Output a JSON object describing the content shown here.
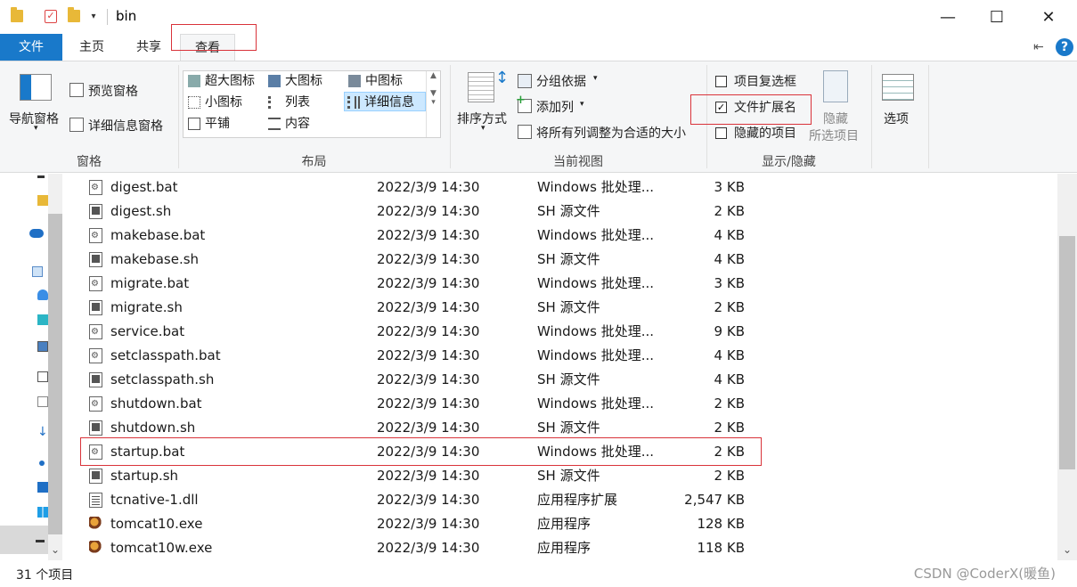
{
  "window": {
    "title": "bin",
    "minimize": "—",
    "maximize": "☐",
    "close": "✕"
  },
  "ribbon_tabs": {
    "file": "文件",
    "home": "主页",
    "share": "共享",
    "view": "查看"
  },
  "ribbon": {
    "panes": {
      "nav_pane": "导航窗格",
      "preview_pane": "预览窗格",
      "details_pane": "详细信息窗格",
      "group_label": "窗格"
    },
    "layout": {
      "items": [
        "超大图标",
        "大图标",
        "中图标",
        "小图标",
        "列表",
        "详细信息",
        "平铺",
        "内容"
      ],
      "selected": "详细信息",
      "group_label": "布局"
    },
    "current_view": {
      "sort_by": "排序方式",
      "group_by": "分组依据",
      "add_column": "添加列",
      "fit_columns": "将所有列调整为合适的大小",
      "group_label": "当前视图"
    },
    "show_hide": {
      "item_checkboxes": "项目复选框",
      "file_extensions": "文件扩展名",
      "hidden_items": "隐藏的项目",
      "hide_selected": "隐藏",
      "hide_selected_2": "所选项目",
      "group_label": "显示/隐藏",
      "checks": {
        "item_checkboxes": false,
        "file_extensions": true,
        "hidden_items": false
      }
    },
    "options": "选项"
  },
  "files": [
    {
      "name": "digest.bat",
      "date": "2022/3/9 14:30",
      "type": "Windows 批处理...",
      "size": "3 KB",
      "icon": "bat"
    },
    {
      "name": "digest.sh",
      "date": "2022/3/9 14:30",
      "type": "SH 源文件",
      "size": "2 KB",
      "icon": "sh"
    },
    {
      "name": "makebase.bat",
      "date": "2022/3/9 14:30",
      "type": "Windows 批处理...",
      "size": "4 KB",
      "icon": "bat"
    },
    {
      "name": "makebase.sh",
      "date": "2022/3/9 14:30",
      "type": "SH 源文件",
      "size": "4 KB",
      "icon": "sh"
    },
    {
      "name": "migrate.bat",
      "date": "2022/3/9 14:30",
      "type": "Windows 批处理...",
      "size": "3 KB",
      "icon": "bat"
    },
    {
      "name": "migrate.sh",
      "date": "2022/3/9 14:30",
      "type": "SH 源文件",
      "size": "2 KB",
      "icon": "sh"
    },
    {
      "name": "service.bat",
      "date": "2022/3/9 14:30",
      "type": "Windows 批处理...",
      "size": "9 KB",
      "icon": "bat"
    },
    {
      "name": "setclasspath.bat",
      "date": "2022/3/9 14:30",
      "type": "Windows 批处理...",
      "size": "4 KB",
      "icon": "bat"
    },
    {
      "name": "setclasspath.sh",
      "date": "2022/3/9 14:30",
      "type": "SH 源文件",
      "size": "4 KB",
      "icon": "sh"
    },
    {
      "name": "shutdown.bat",
      "date": "2022/3/9 14:30",
      "type": "Windows 批处理...",
      "size": "2 KB",
      "icon": "bat"
    },
    {
      "name": "shutdown.sh",
      "date": "2022/3/9 14:30",
      "type": "SH 源文件",
      "size": "2 KB",
      "icon": "sh"
    },
    {
      "name": "startup.bat",
      "date": "2022/3/9 14:30",
      "type": "Windows 批处理...",
      "size": "2 KB",
      "icon": "bat"
    },
    {
      "name": "startup.sh",
      "date": "2022/3/9 14:30",
      "type": "SH 源文件",
      "size": "2 KB",
      "icon": "sh"
    },
    {
      "name": "tcnative-1.dll",
      "date": "2022/3/9 14:30",
      "type": "应用程序扩展",
      "size": "2,547 KB",
      "icon": "dll"
    },
    {
      "name": "tomcat10.exe",
      "date": "2022/3/9 14:30",
      "type": "应用程序",
      "size": "128 KB",
      "icon": "exe"
    },
    {
      "name": "tomcat10w.exe",
      "date": "2022/3/9 14:30",
      "type": "应用程序",
      "size": "118 KB",
      "icon": "exe"
    }
  ],
  "status": {
    "item_count": "31 个项目",
    "watermark": "CSDN @CoderX(暖鱼)"
  },
  "colors": {
    "accent": "#1979ca",
    "annotation_red": "#d9333a",
    "selected_bg": "#cce8ff"
  }
}
